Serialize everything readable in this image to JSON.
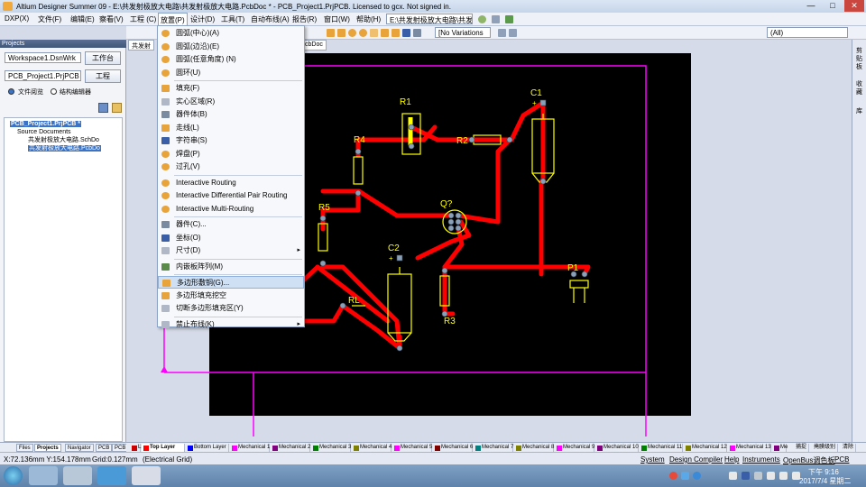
{
  "window": {
    "title": "Altium Designer Summer 09 - E:\\共发射极放大电路\\共发射极放大电路.PcbDoc * - PCB_Project1.PrjPCB. Licensed to gcx. Not signed in.",
    "min": "—",
    "max": "□",
    "close": "✕"
  },
  "menubar": {
    "items": [
      "DXP(X)",
      "文件(F)",
      "编辑(E)",
      "察看(V)",
      "工程 (C)",
      "放置(P)",
      "设计(D)",
      "工具(T)",
      "自动布线(A)",
      "报告(R)",
      "窗口(W)",
      "帮助(H)"
    ],
    "path_combo": "E:\\共发射极放大电路\\共发射",
    "no_variations": "[No Variations",
    "all_combo": "(All)"
  },
  "place_menu": {
    "items": [
      {
        "label": "圆弧(中心)(A)",
        "icon": "arc-center-icon",
        "color": "#e8a33a"
      },
      {
        "label": "圆弧(边沿)(E)",
        "icon": "arc-edge-icon",
        "color": "#e8a33a"
      },
      {
        "label": "圆弧(任意角度) (N)",
        "icon": "arc-any-icon",
        "color": "#e8a33a"
      },
      {
        "label": "圆环(U)",
        "icon": "full-circle-icon",
        "color": "#e8a33a"
      },
      {
        "label": "填充(F)",
        "icon": "fill-icon",
        "color": "#e8a33a"
      },
      {
        "label": "实心区域(R)",
        "icon": "solid-region-icon",
        "color": "#b0b8c8"
      },
      {
        "label": "器件体(B)",
        "icon": "3d-body-icon",
        "color": "#7a8aa0"
      },
      {
        "label": "走线(L)",
        "icon": "line-icon",
        "color": "#e8a33a"
      },
      {
        "label": "字符串(S)",
        "icon": "string-icon",
        "color": "#3a5ea8"
      },
      {
        "label": "焊盘(P)",
        "icon": "pad-icon",
        "color": "#e8a33a"
      },
      {
        "label": "过孔(V)",
        "icon": "via-icon",
        "color": "#e8a33a"
      },
      {
        "label": "Interactive Routing",
        "icon": "interactive-routing-icon",
        "color": "#e8a33a"
      },
      {
        "label": "Interactive Differential Pair Routing",
        "icon": "diff-pair-routing-icon",
        "color": "#e8a33a"
      },
      {
        "label": "Interactive Multi-Routing",
        "icon": "multi-routing-icon",
        "color": "#e8a33a"
      },
      {
        "label": "器件(C)...",
        "icon": "component-icon",
        "color": "#7a8aa0"
      },
      {
        "label": "坐标(O)",
        "icon": "coordinate-icon",
        "color": "#3a5ea8"
      },
      {
        "label": "尺寸(D)",
        "icon": "dimension-icon",
        "color": "#b0b8c8",
        "submenu": true
      },
      {
        "label": "内嵌板阵列(M)",
        "icon": "embedded-board-icon",
        "color": "#5a8a4a"
      },
      {
        "label": "多边形敷铜(G)...",
        "icon": "polygon-pour-icon",
        "color": "#e8a33a",
        "highlighted": true
      },
      {
        "label": "多边形填充挖空",
        "icon": "polygon-cutout-icon",
        "color": "#e8a33a"
      },
      {
        "label": "切断多边形填充区(Y)",
        "icon": "slice-polygon-icon",
        "color": "#b0b8c8"
      },
      {
        "label": "禁止布线(K)",
        "icon": "keepout-icon",
        "color": "#b0b8c8",
        "submenu": true
      }
    ],
    "submenu_arrow": "▸"
  },
  "projects_panel": {
    "header": "Projects",
    "workspace_value": "Workspace1.DsnWrk",
    "workspace_btn": "工作台",
    "project_value": "PCB_Project1.PrjPCB",
    "project_btn": "工程",
    "radio_file_view": "文件阅览",
    "radio_struct_editor": "结构编辑器",
    "tree": {
      "project": "PCB_Project1.PrjPCB *",
      "folder": "Source Documents",
      "sch": "共发射极放大电路.SchDo",
      "pcb": "共发射极放大电路.PcbDo"
    }
  },
  "doc_tabs": [
    "共发射",
    "cbDoc"
  ],
  "pcb": {
    "labels": {
      "r1": "R1",
      "r2": "R2",
      "r3": "R3",
      "r4": "R4",
      "r5": "R5",
      "rl": "RL",
      "c1": "C1",
      "c2": "C2",
      "q": "Q?",
      "p1": "P1"
    },
    "plus": "+",
    "colors": {
      "board": "#000000",
      "track": "#ff0000",
      "silk": "#ffff00",
      "outline": "#ff00ff",
      "pad": "#8aa0b8"
    }
  },
  "panel_tabs": [
    "Files",
    "Projects",
    "Navigator",
    "PCB",
    "PCB"
  ],
  "layer_tabs": [
    {
      "label": "LS",
      "color": "#cc0000"
    },
    {
      "label": "Top Layer",
      "color": "#ff0000"
    },
    {
      "label": "Bottom Layer",
      "color": "#0000ff"
    },
    {
      "label": "Mechanical 1",
      "color": "#ff00ff"
    },
    {
      "label": "Mechanical 2",
      "color": "#800080"
    },
    {
      "label": "Mechanical 3",
      "color": "#008000"
    },
    {
      "label": "Mechanical 4",
      "color": "#808000"
    },
    {
      "label": "Mechanical 5",
      "color": "#ff00ff"
    },
    {
      "label": "Mechanical 6",
      "color": "#800000"
    },
    {
      "label": "Mechanical 7",
      "color": "#008080"
    },
    {
      "label": "Mechanical 8",
      "color": "#808000"
    },
    {
      "label": "Mechanical 9",
      "color": "#ff00ff"
    },
    {
      "label": "Mechanical 10",
      "color": "#800080"
    },
    {
      "label": "Mechanical 11",
      "color": "#008000"
    },
    {
      "label": "Mechanical 12",
      "color": "#808000"
    },
    {
      "label": "Mechanical 13",
      "color": "#ff00ff"
    },
    {
      "label": "Me",
      "color": "#800080"
    }
  ],
  "layer_right": {
    "snap": "捕捉",
    "mask": "掩膜级别",
    "clear": "清除"
  },
  "status": {
    "coords": "X:72.136mm Y:154.178mm",
    "grid": "Grid:0.127mm",
    "grid_type": "(Electrical Grid)",
    "links": [
      "System",
      "Design Compiler",
      "Help",
      "Instruments",
      "OpenBus调色板",
      "PCB"
    ]
  },
  "taskbar": {
    "time": "下午 9:16",
    "date": "2017/7/4 星期二"
  },
  "right_strip": [
    "剪贴板",
    "收藏",
    "库"
  ]
}
